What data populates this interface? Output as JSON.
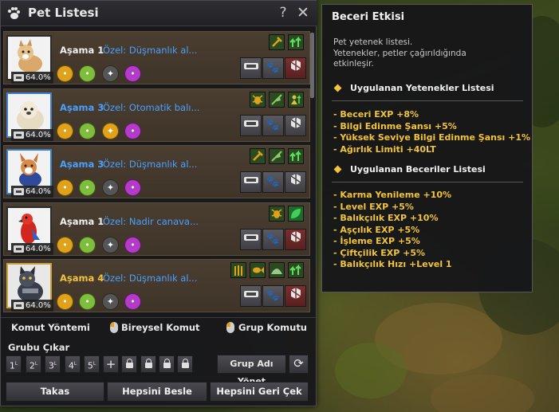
{
  "window": {
    "title": "Pet Listesi",
    "help_label": "?",
    "close_label": "✕"
  },
  "pets": [
    {
      "stage": "Aşama 1",
      "stage_color": "white",
      "special": "Özel: Düşmanlık al...",
      "exp": "64.0%",
      "frame": "default",
      "species": "dog-white"
    },
    {
      "stage": "Aşama 3",
      "stage_color": "blue",
      "special": "Özel: Otomatik balı...",
      "exp": "64.0%",
      "frame": "blue",
      "species": "seal"
    },
    {
      "stage": "Aşama 3",
      "stage_color": "blue",
      "special": "Özel: Düşmanlık al...",
      "exp": "64.0%",
      "frame": "blue",
      "species": "dog-corgi"
    },
    {
      "stage": "Aşama 1",
      "stage_color": "white",
      "special": "Özel: Nadir canava...",
      "exp": "64.0%",
      "frame": "default",
      "species": "parrot"
    },
    {
      "stage": "Aşama 4",
      "stage_color": "gold",
      "special": "Özel: Düşmanlık al...",
      "exp": "64.0%",
      "frame": "gold",
      "species": "armored-cat"
    }
  ],
  "command": {
    "method": "Komut Yöntemi",
    "individual": "Bireysel Komut",
    "group": "Grup Komutu"
  },
  "group": {
    "label": "Grubu Çıkar",
    "slots": [
      "1",
      "2",
      "3",
      "4",
      "5"
    ],
    "add": "+",
    "manage": "Grup Adı Yönet",
    "refresh": "⟳"
  },
  "bottom": {
    "exchange": "Takas",
    "feed_all": "Hepsini Besle",
    "recall_all": "Hepsini Geri Çek"
  },
  "tooltip": {
    "title": "Beceri Etkisi",
    "notes": [
      " Pet yetenek listesi.",
      " Yetenekler, petler çağırıldığında",
      "etkinleşir."
    ],
    "abilities_header": "Uygulanan Yetenekler Listesi",
    "abilities": [
      "- Beceri EXP +8%",
      "- Bilgi Edinme Şansı +5%",
      "- Yüksek Seviye Bilgi Edinme Şansı +1%",
      "- Ağırlık Limiti +40LT"
    ],
    "skills_header": "Uygulanan Beceriler Listesi",
    "skills": [
      "- Karma Yenileme +10%",
      "- Level EXP +5%",
      "- Balıkçılık EXP +10%",
      "- Aşçılık EXP +5%",
      "- İşleme EXP +5%",
      "- Çiftçilik EXP +5%",
      "- Balıkçılık Hızı +Level 1"
    ]
  }
}
